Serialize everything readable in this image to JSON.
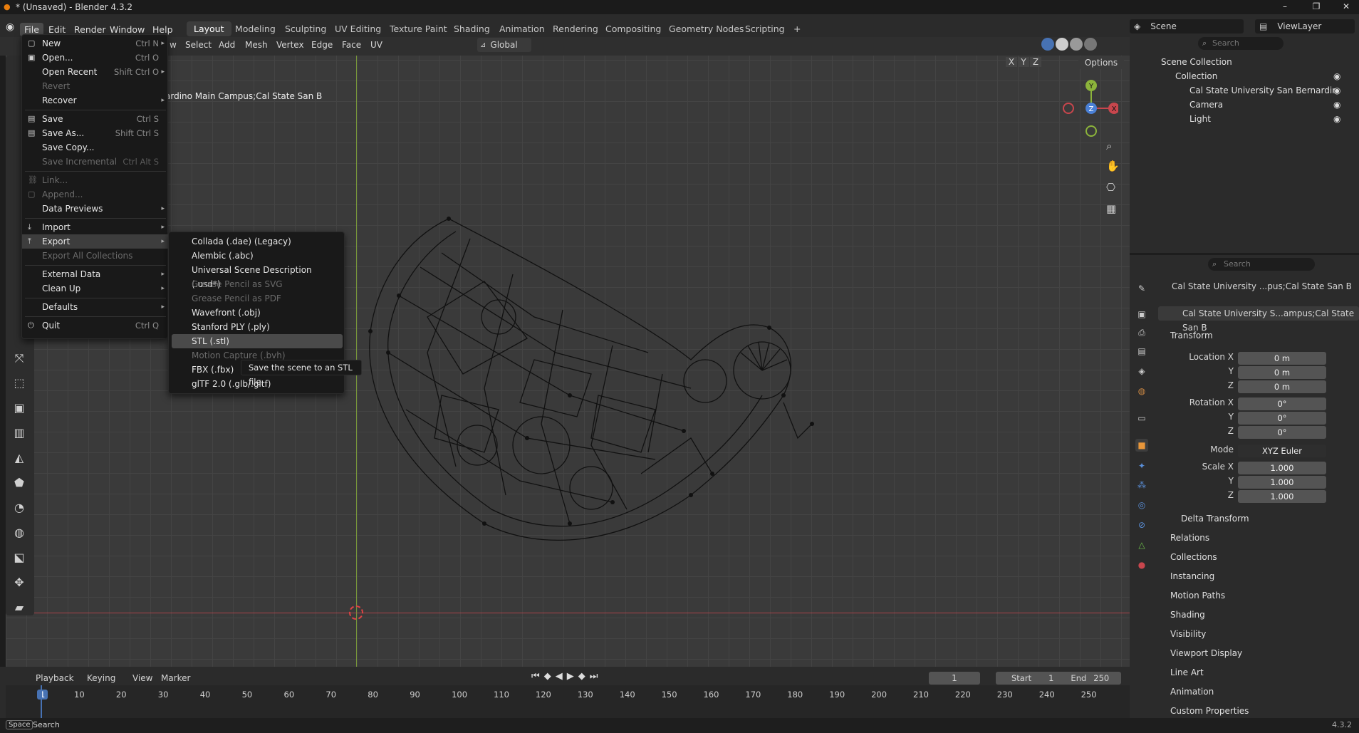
{
  "window": {
    "title": "* (Unsaved) - Blender 4.3.2",
    "minimize": "–",
    "restore": "❐",
    "close": "✕"
  },
  "menubar": {
    "items": [
      "File",
      "Edit",
      "Render",
      "Window",
      "Help"
    ]
  },
  "workspaces": [
    "Layout",
    "Modeling",
    "Sculpting",
    "UV Editing",
    "Texture Paint",
    "Shading",
    "Animation",
    "Rendering",
    "Compositing",
    "Geometry Nodes",
    "Scripting"
  ],
  "workspace_add": "+",
  "scene": {
    "label": "Scene",
    "viewlayer": "ViewLayer"
  },
  "viewport_header": {
    "menus": [
      "w",
      "Select",
      "Add",
      "Mesh",
      "Vertex",
      "Edge",
      "Face",
      "UV"
    ],
    "orientation": "Global",
    "options": "Options",
    "axes": [
      "X",
      "Y",
      "Z"
    ]
  },
  "viewport": {
    "object_label": "ardino Main Campus;Cal State San B",
    "gizmo": {
      "y": "Y",
      "z": "Z",
      "x": "X"
    }
  },
  "file_menu": {
    "items": [
      {
        "label": "New",
        "shortcut": "Ctrl N",
        "arrow": "▸",
        "icon": "▢",
        "disabled": false
      },
      {
        "label": "Open...",
        "shortcut": "Ctrl O",
        "icon": "▣",
        "disabled": false
      },
      {
        "label": "Open Recent",
        "shortcut": "Shift Ctrl O",
        "arrow": "▸",
        "disabled": false
      },
      {
        "label": "Revert",
        "disabled": true
      },
      {
        "label": "Recover",
        "arrow": "▸",
        "disabled": false
      },
      {
        "label": "Save",
        "shortcut": "Ctrl S",
        "icon": "▤",
        "disabled": false
      },
      {
        "label": "Save As...",
        "shortcut": "Shift Ctrl S",
        "icon": "▤",
        "disabled": false
      },
      {
        "label": "Save Copy...",
        "disabled": false
      },
      {
        "label": "Save Incremental",
        "shortcut": "Ctrl Alt S",
        "disabled": true
      },
      {
        "label": "Link...",
        "icon": "⛓",
        "disabled": true
      },
      {
        "label": "Append...",
        "icon": "▢",
        "disabled": true
      },
      {
        "label": "Data Previews",
        "arrow": "▸",
        "disabled": false
      },
      {
        "label": "Import",
        "arrow": "▸",
        "icon": "⤓",
        "disabled": false
      },
      {
        "label": "Export",
        "arrow": "▸",
        "icon": "⤒",
        "disabled": false
      },
      {
        "label": "Export All Collections",
        "disabled": true
      },
      {
        "label": "External Data",
        "arrow": "▸",
        "disabled": false
      },
      {
        "label": "Clean Up",
        "arrow": "▸",
        "disabled": false
      },
      {
        "label": "Defaults",
        "arrow": "▸",
        "disabled": false
      },
      {
        "label": "Quit",
        "shortcut": "Ctrl Q",
        "icon": "⏻",
        "disabled": false
      }
    ]
  },
  "export_menu": {
    "items": [
      {
        "label": "Collada (.dae) (Legacy)",
        "disabled": false
      },
      {
        "label": "Alembic (.abc)",
        "disabled": false
      },
      {
        "label": "Universal Scene Description (.usd*)",
        "disabled": false
      },
      {
        "label": "Grease Pencil as SVG",
        "disabled": true
      },
      {
        "label": "Grease Pencil as PDF",
        "disabled": true
      },
      {
        "label": "Wavefront (.obj)",
        "disabled": false
      },
      {
        "label": "Stanford PLY (.ply)",
        "disabled": false
      },
      {
        "label": "STL (.stl)",
        "disabled": false
      },
      {
        "label": "Motion Capture (.bvh)",
        "disabled": true
      },
      {
        "label": "FBX (.fbx)",
        "disabled": false
      },
      {
        "label": "glTF 2.0 (.glb/.gltf)",
        "disabled": false
      }
    ],
    "tooltip": "Save the scene to an STL file."
  },
  "outliner": {
    "search_placeholder": "Search",
    "root": "Scene Collection",
    "collection": "Collection",
    "objects": [
      "Cal State University San Bernardir",
      "Camera",
      "Light"
    ]
  },
  "properties": {
    "search_placeholder": "Search",
    "object_name": "Cal State University ...pus;Cal State San B",
    "mesh_name": "Cal State University S...ampus;Cal State San B",
    "transform_header": "Transform",
    "location": {
      "label_x": "Location X",
      "x": "0 m",
      "y": "0 m",
      "z": "0 m"
    },
    "rotation": {
      "label_x": "Rotation X",
      "x": "0°",
      "y": "0°",
      "z": "0°"
    },
    "mode_label": "Mode",
    "mode": "XYZ Euler",
    "scale": {
      "label_x": "Scale X",
      "x": "1.000",
      "y": "1.000",
      "z": "1.000"
    },
    "axis_y": "Y",
    "axis_z": "Z",
    "sections": [
      "Delta Transform",
      "Relations",
      "Collections",
      "Instancing",
      "Motion Paths",
      "Shading",
      "Visibility",
      "Viewport Display",
      "Line Art",
      "Animation",
      "Custom Properties"
    ]
  },
  "timeline": {
    "menus": [
      "Playback",
      "Keying",
      "View",
      "Marker"
    ],
    "current_frame": "1",
    "start_label": "Start",
    "start": "1",
    "end_label": "End",
    "end": "250",
    "ticks": [
      "1",
      "10",
      "20",
      "30",
      "40",
      "50",
      "60",
      "70",
      "80",
      "90",
      "100",
      "110",
      "120",
      "130",
      "140",
      "150",
      "160",
      "170",
      "180",
      "190",
      "200",
      "210",
      "220",
      "230",
      "240",
      "250"
    ]
  },
  "statusbar": {
    "key": "Space",
    "action": "Search",
    "version": "4.3.2"
  },
  "colors": {
    "accent": "#4772b3",
    "x_axis": "#c8464d",
    "y_axis": "#8cb43b",
    "z_axis": "#4a80d6"
  }
}
